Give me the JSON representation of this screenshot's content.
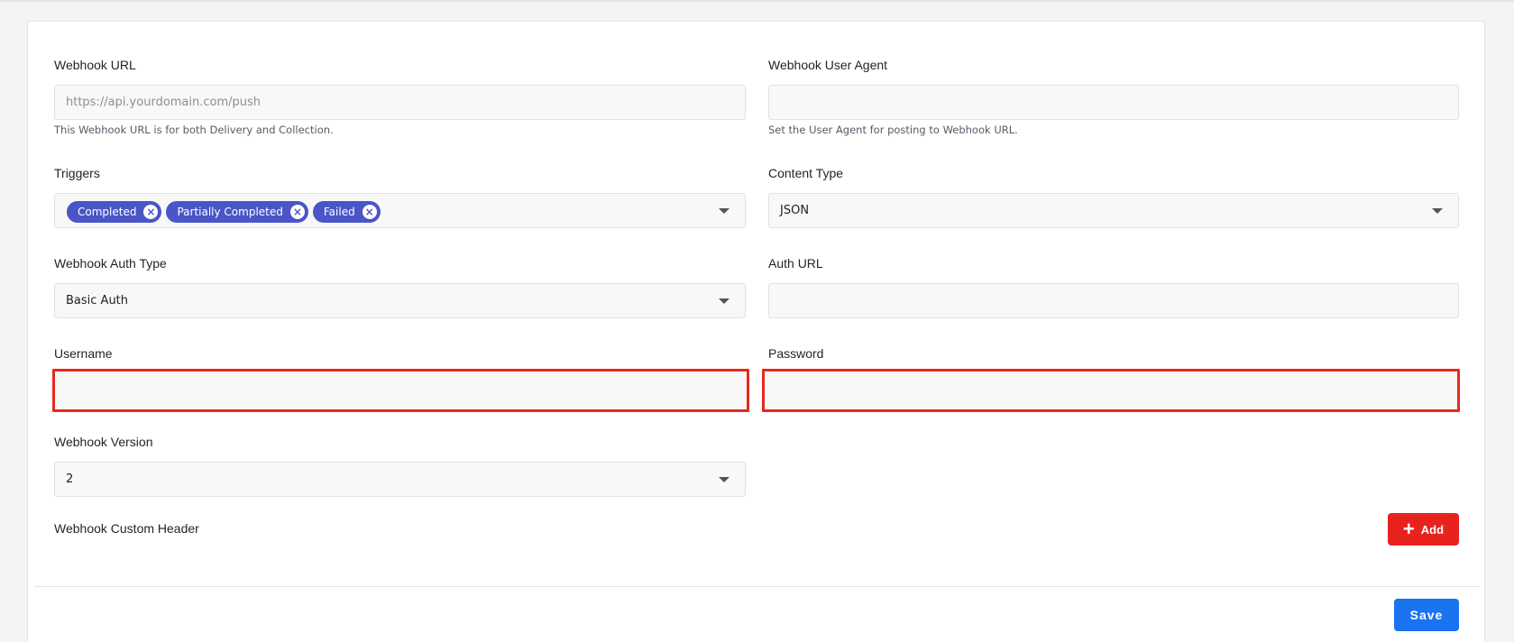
{
  "webhook_url": {
    "label": "Webhook URL",
    "placeholder": "https://api.yourdomain.com/push",
    "value": "",
    "help": "This Webhook URL is for both Delivery and Collection."
  },
  "webhook_user_agent": {
    "label": "Webhook User Agent",
    "value": "",
    "help": "Set the User Agent for posting to Webhook URL."
  },
  "triggers": {
    "label": "Triggers",
    "chips": [
      "Completed",
      "Partially Completed",
      "Failed"
    ],
    "chip_color": "#4a55c8"
  },
  "content_type": {
    "label": "Content Type",
    "value": "JSON"
  },
  "auth_type": {
    "label": "Webhook Auth Type",
    "value": "Basic Auth"
  },
  "auth_url": {
    "label": "Auth URL",
    "value": ""
  },
  "username": {
    "label": "Username",
    "value": "",
    "state": "error"
  },
  "password": {
    "label": "Password",
    "value": "",
    "state": "error"
  },
  "webhook_version": {
    "label": "Webhook Version",
    "value": "2"
  },
  "custom_header": {
    "label": "Webhook Custom Header",
    "add_label": "Add",
    "add_icon": "plus-icon"
  },
  "footer": {
    "save_label": "Save"
  },
  "colors": {
    "error_border": "#e8291c",
    "add_button": "#e8231e",
    "save_button": "#1a73f0"
  }
}
